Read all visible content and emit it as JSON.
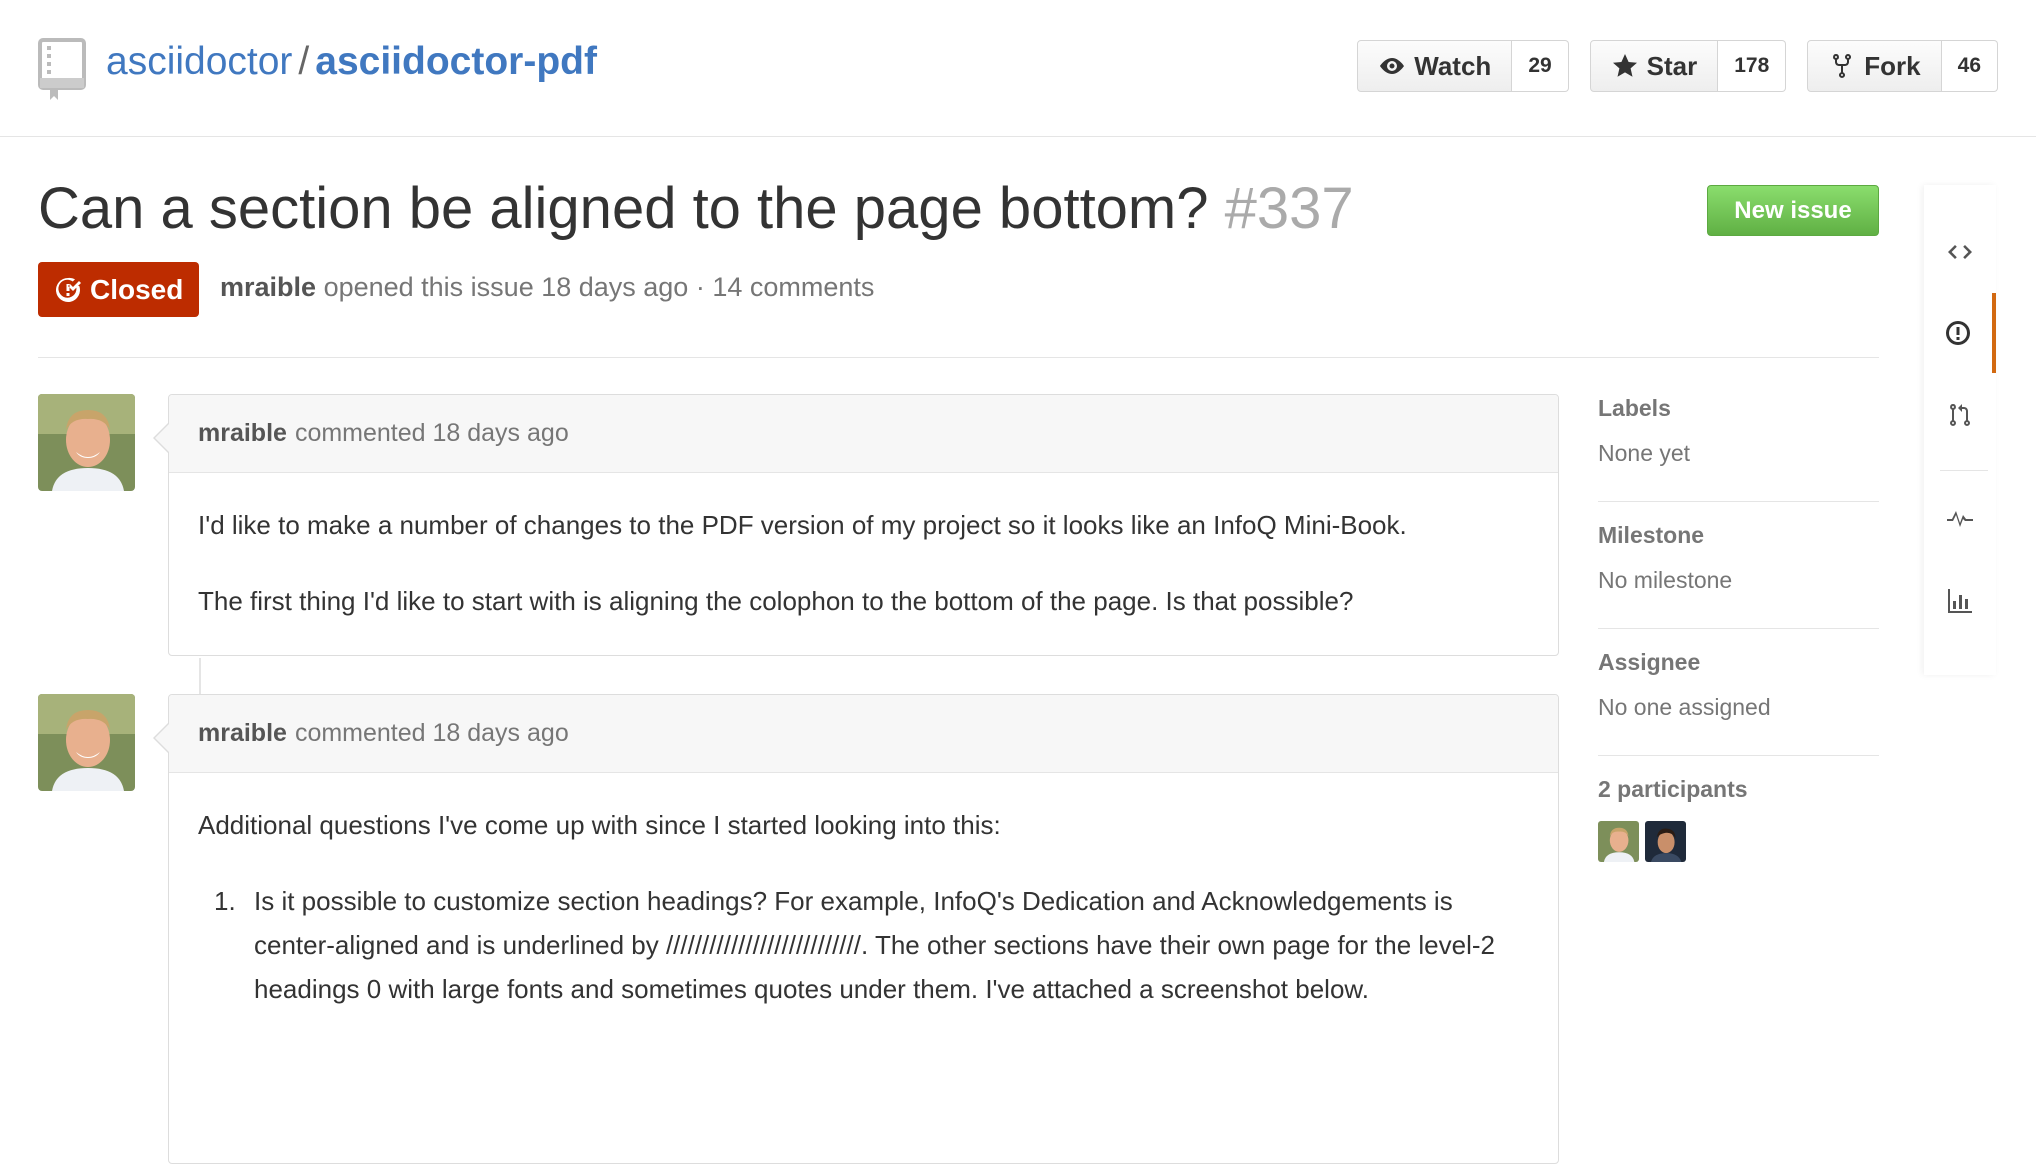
{
  "repo": {
    "owner": "asciidoctor",
    "separator": "/",
    "name": "asciidoctor-pdf"
  },
  "actions": {
    "watch": {
      "label": "Watch",
      "count": "29"
    },
    "star": {
      "label": "Star",
      "count": "178"
    },
    "fork": {
      "label": "Fork",
      "count": "46"
    }
  },
  "issue": {
    "title": "Can a section be aligned to the page bottom?",
    "number": "#337",
    "state": "Closed",
    "author": "mraible",
    "meta": "opened this issue 18 days ago · 14 comments",
    "new_issue_label": "New issue"
  },
  "comments": [
    {
      "author": "mraible",
      "meta": "commented 18 days ago",
      "paragraphs": [
        "I'd like to make a number of changes to the PDF version of my project so it looks like an InfoQ Mini-Book.",
        "The first thing I'd like to start with is aligning the colophon to the bottom of the page. Is that possible?"
      ]
    },
    {
      "author": "mraible",
      "meta": "commented 18 days ago",
      "intro": "Additional questions I've come up with since I started looking into this:",
      "list": [
        {
          "number": "1.",
          "text": "Is it possible to customize section headings? For example, InfoQ's Dedication and Acknowledgements is center-aligned and is underlined by ///////////////////////////. The other sections have their own page for the level-2 headings 0 with large fonts and sometimes quotes under them. I've attached a screenshot below."
        }
      ]
    }
  ],
  "sidebar": {
    "labels": {
      "heading": "Labels",
      "value": "None yet"
    },
    "milestone": {
      "heading": "Milestone",
      "value": "No milestone"
    },
    "assignee": {
      "heading": "Assignee",
      "value": "No one assigned"
    },
    "participants": {
      "heading": "2 participants"
    }
  },
  "reponav": [
    "code-icon",
    "issue-icon",
    "pull-request-icon",
    "pulse-icon",
    "graph-icon"
  ],
  "colors": {
    "link": "#4078c0",
    "closed": "#bd2c00",
    "new_issue_green": "#60b044",
    "selected_tab": "#d26911"
  }
}
